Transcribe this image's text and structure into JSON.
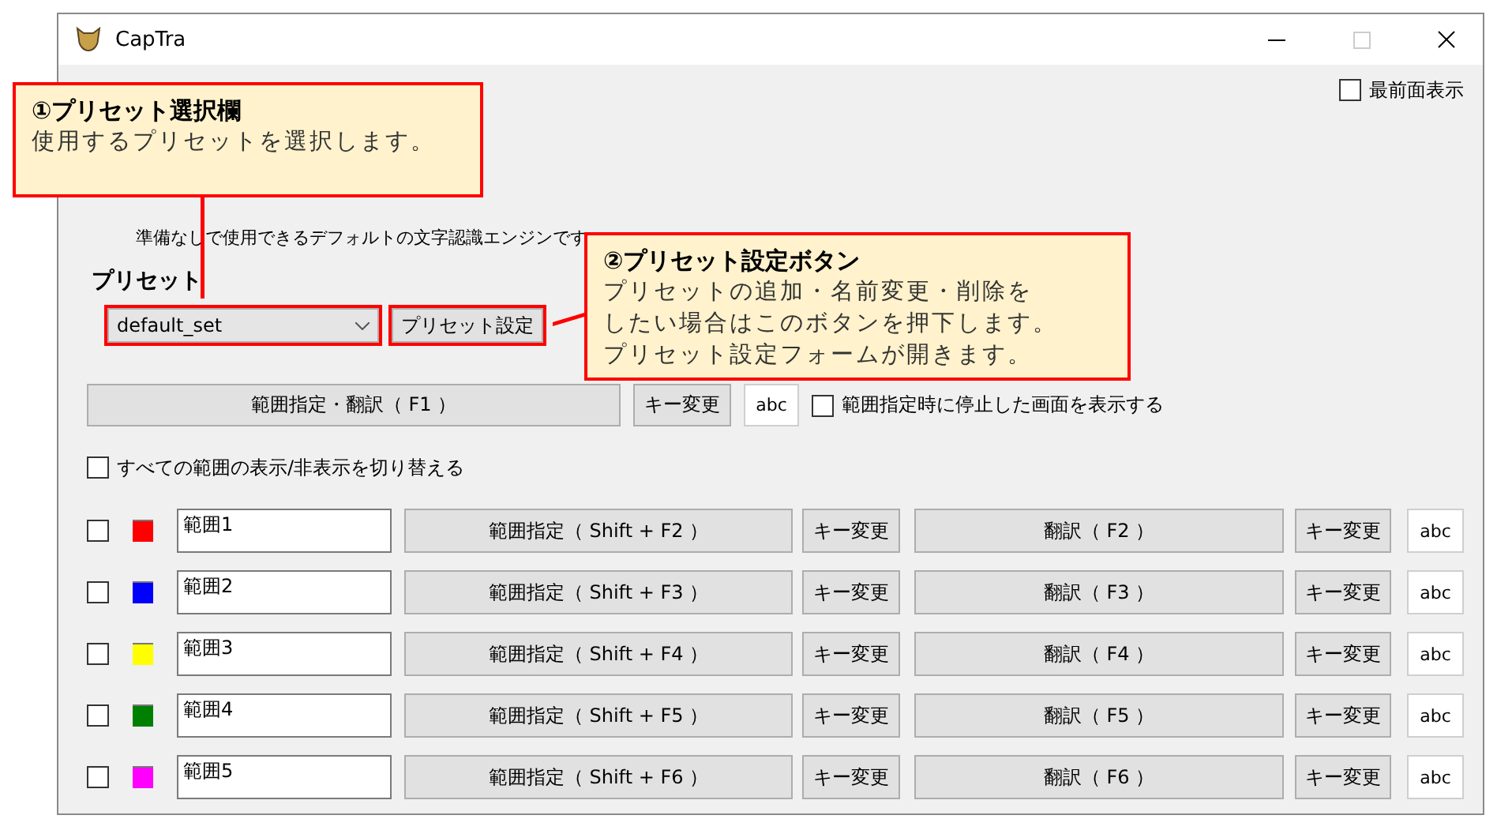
{
  "window": {
    "title": "CapTra",
    "maximize_disabled": true
  },
  "topmost": {
    "label": "最前面表示",
    "checked": false
  },
  "engine": {
    "description": "準備なしで使用できるデフォルトの文字認識エンジンです"
  },
  "preset": {
    "label": "プリセット",
    "value": "default_set",
    "highlighted": true,
    "settings_button": {
      "label": "プリセット設定",
      "highlighted": true
    }
  },
  "main": {
    "capture_button": "範囲指定・翻訳（ F1 ）",
    "key_button": "キー変更",
    "abc": "abc",
    "show_frozen": {
      "label": "範囲指定時に停止した画面を表示する",
      "checked": false
    }
  },
  "toggle_all": {
    "label": "すべての範囲の表示/非表示を切り替える",
    "checked": false
  },
  "ranges": [
    {
      "checked": false,
      "color": "#ff0000",
      "name": "範囲1",
      "select_button": "範囲指定（ Shift + F2 ）",
      "select_key": "キー変更",
      "translate_button": "翻訳（ F2 ）",
      "translate_key": "キー変更",
      "abc": "abc"
    },
    {
      "checked": false,
      "color": "#0000ff",
      "name": "範囲2",
      "select_button": "範囲指定（ Shift + F3 ）",
      "select_key": "キー変更",
      "translate_button": "翻訳（ F3 ）",
      "translate_key": "キー変更",
      "abc": "abc"
    },
    {
      "checked": false,
      "color": "#ffff00",
      "name": "範囲3",
      "select_button": "範囲指定（ Shift + F4 ）",
      "select_key": "キー変更",
      "translate_button": "翻訳（ F4 ）",
      "translate_key": "キー変更",
      "abc": "abc"
    },
    {
      "checked": false,
      "color": "#008000",
      "name": "範囲4",
      "select_button": "範囲指定（ Shift + F5 ）",
      "select_key": "キー変更",
      "translate_button": "翻訳（ F5 ）",
      "translate_key": "キー変更",
      "abc": "abc"
    },
    {
      "checked": false,
      "color": "#ff00ff",
      "name": "範囲5",
      "select_button": "範囲指定（ Shift + F6 ）",
      "select_key": "キー変更",
      "translate_button": "翻訳（ F6 ）",
      "translate_key": "キー変更",
      "abc": "abc"
    }
  ],
  "callouts": [
    {
      "title": "①プリセット選択欄",
      "body": [
        "使用するプリセットを選択します。"
      ]
    },
    {
      "title": "②プリセット設定ボタン",
      "body": [
        "プリセットの追加・名前変更・削除を",
        "したい場合はこのボタンを押下します。",
        "プリセット設定フォームが開きます。"
      ]
    }
  ]
}
